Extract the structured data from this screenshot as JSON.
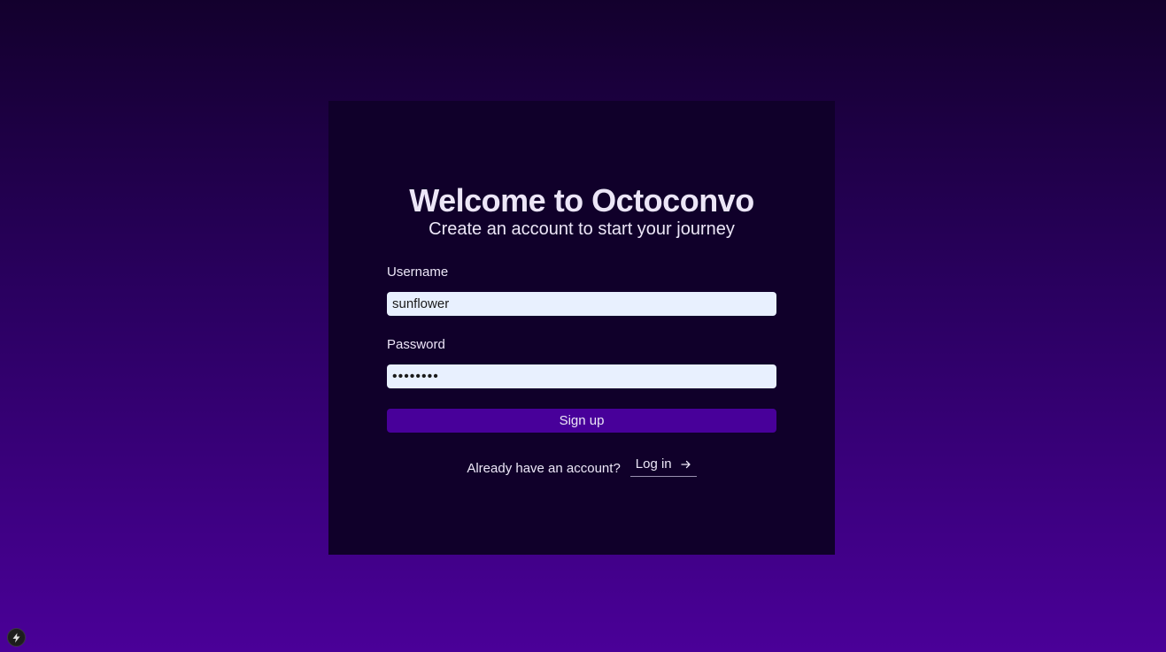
{
  "card": {
    "title": "Welcome to Octoconvo",
    "subtitle": "Create an account to start your journey"
  },
  "form": {
    "username": {
      "label": "Username",
      "value": "sunflower"
    },
    "password": {
      "label": "Password",
      "value": "password"
    },
    "submit_label": "Sign up"
  },
  "login": {
    "prompt": "Already have an account?",
    "link_label": "Log in",
    "icon": "arrow-right-icon"
  },
  "badge": {
    "icon": "lightning-bolt-icon"
  },
  "colors": {
    "background_top": "#13002d",
    "background_bottom": "#4a0098",
    "card": "#10002a",
    "button": "#48009a",
    "input": "#e8f0fe"
  }
}
